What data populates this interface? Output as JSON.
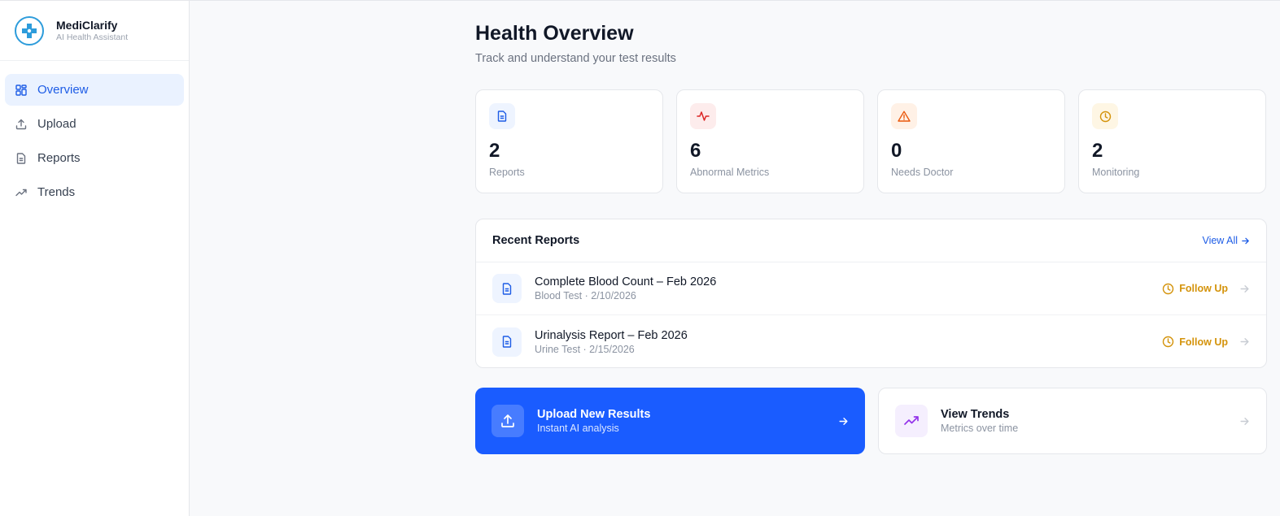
{
  "brand": {
    "name": "MediClarify",
    "subtitle": "AI Health Assistant"
  },
  "nav": [
    {
      "label": "Overview",
      "icon": "grid-icon",
      "active": true
    },
    {
      "label": "Upload",
      "icon": "upload-icon",
      "active": false
    },
    {
      "label": "Reports",
      "icon": "document-icon",
      "active": false
    },
    {
      "label": "Trends",
      "icon": "trending-up-icon",
      "active": false
    }
  ],
  "header": {
    "title": "Health Overview",
    "subtitle": "Track and understand your test results"
  },
  "stats": [
    {
      "value": "2",
      "label": "Reports",
      "icon": "document-icon",
      "color": "#1d5ce6",
      "bg": "#eef4ff"
    },
    {
      "value": "6",
      "label": "Abnormal Metrics",
      "icon": "activity-icon",
      "color": "#dc2626",
      "bg": "#fdecec"
    },
    {
      "value": "0",
      "label": "Needs Doctor",
      "icon": "warning-icon",
      "color": "#ea580c",
      "bg": "#fff1e6"
    },
    {
      "value": "2",
      "label": "Monitoring",
      "icon": "clock-icon",
      "color": "#d4930b",
      "bg": "#fef6e4"
    }
  ],
  "recent": {
    "title": "Recent Reports",
    "view_all": "View All",
    "reports": [
      {
        "title": "Complete Blood Count – Feb 2026",
        "meta": "Blood Test · 2/10/2026",
        "status": "Follow Up"
      },
      {
        "title": "Urinalysis Report – Feb 2026",
        "meta": "Urine Test · 2/15/2026",
        "status": "Follow Up"
      }
    ]
  },
  "actions": {
    "upload": {
      "title": "Upload New Results",
      "subtitle": "Instant AI analysis"
    },
    "trends": {
      "title": "View Trends",
      "subtitle": "Metrics over time"
    }
  },
  "colors": {
    "accent": "#1a5cff",
    "warning": "#d4930b",
    "trends": "#9333ea"
  }
}
